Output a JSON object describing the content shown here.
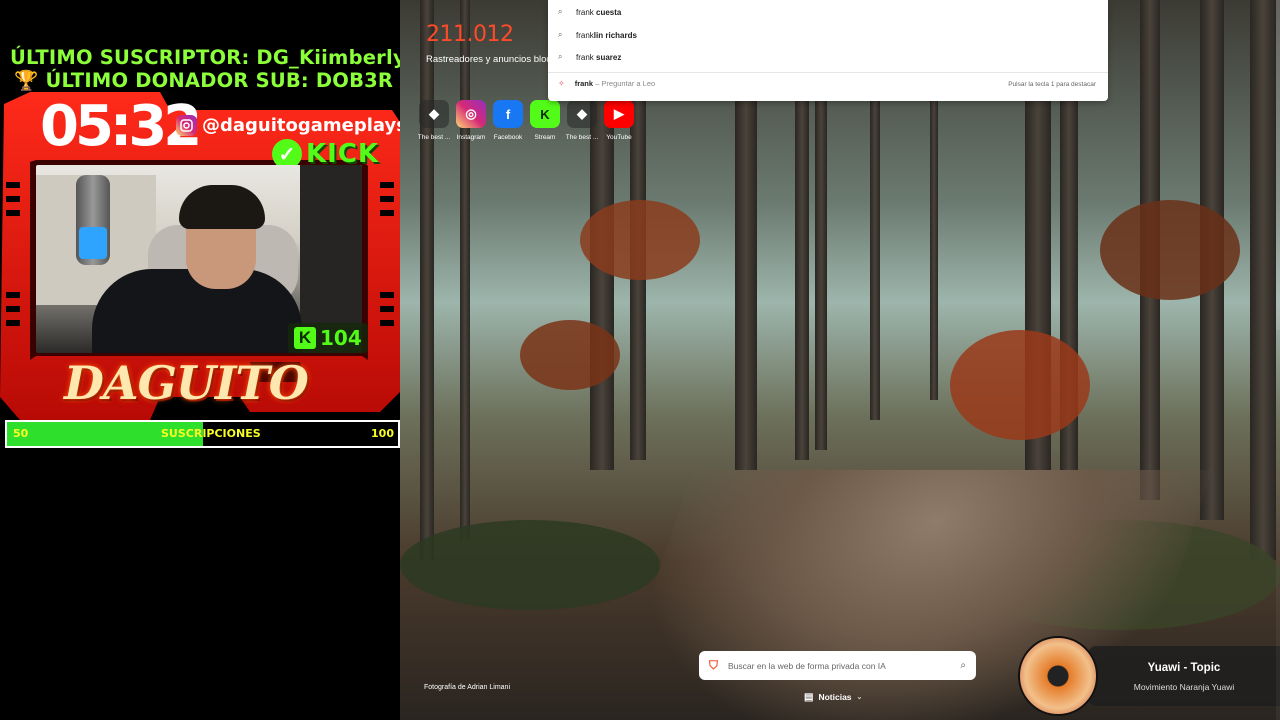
{
  "overlay": {
    "last_subscriber": "ÚLTIMO SUSCRIPTOR: DG_Kiimberlyy",
    "last_donor": "ÚLTIMO DONADOR SUB: DOB3R",
    "timer": "05:32",
    "instagram_handle": "@daguitogameplays",
    "kick_word": "KICK",
    "viewer_count": "104",
    "brand": "DAGUITO",
    "sub_goal": {
      "min": "50",
      "label": "SUSCRIPCIONES",
      "max": "100",
      "progress_fraction": 0.5
    },
    "accent": "#e3120b"
  },
  "browser": {
    "tracker_count": "211.012",
    "tracker_label": "Rastreadores y anuncios bloq",
    "shortcuts": [
      {
        "label": "The best ...",
        "icon": "brave-icon"
      },
      {
        "label": "Instagram",
        "icon": "instagram-icon"
      },
      {
        "label": "Facebook",
        "icon": "facebook-icon"
      },
      {
        "label": "Stream",
        "icon": "kick-icon"
      },
      {
        "label": "The best ...",
        "icon": "brave-icon"
      },
      {
        "label": "YouTube",
        "icon": "youtube-icon"
      }
    ],
    "suggestions": [
      {
        "prefix": "frank",
        "suffix": " cuesta"
      },
      {
        "prefix": "frank",
        "suffix": "lin richards"
      },
      {
        "prefix": "frank",
        "suffix": " suarez"
      }
    ],
    "leo": {
      "query": "frank",
      "hint": "– Preguntar a Leo",
      "key_hint": "Pulsar la tecla 1 para destacar"
    },
    "photo_credit": "Fotografía de Adrian Limani",
    "search_placeholder": "Buscar en la web de forma privada con IA",
    "news_label": "Noticias",
    "now_playing": {
      "title": "Yuawi - Topic",
      "artist": "Movimiento Naranja Yuawi"
    }
  }
}
